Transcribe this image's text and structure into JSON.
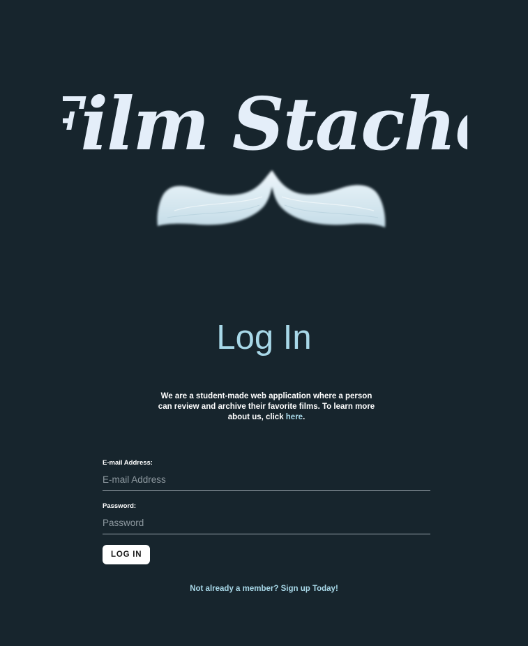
{
  "brand": {
    "logo_text": "Film Stache"
  },
  "page_title": "Log In",
  "intro": {
    "text_before": "We are a student-made web application where a person can review and archive their favorite films. To learn more about us, click ",
    "link_label": "here",
    "text_after": "."
  },
  "form": {
    "email_label": "E-mail Address:",
    "email_placeholder": "E-mail Address",
    "password_label": "Password:",
    "password_placeholder": "Password",
    "submit_label": "LOG IN"
  },
  "signup_link": "Not already a member? Sign up Today!",
  "colors": {
    "background": "#17252d",
    "accent": "#a8d8e8",
    "logo": "#e4eef9"
  }
}
